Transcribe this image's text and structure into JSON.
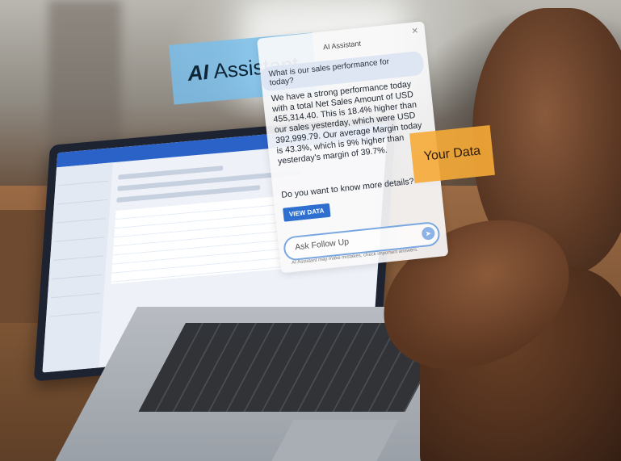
{
  "overlay_label": {
    "ai_bold": "AI",
    "ai_rest": "Assistant"
  },
  "panel": {
    "title": "AI Assistant",
    "question": "What is our sales performance for today?",
    "answer": "We have a strong performance today with a total Net Sales Amount of USD 455,314.40. This is 18.4% higher than our sales yesterday, which were USD 392,999.79. Our average Margin today is 43.3%, which is 9% higher than yesterday's margin of 39.7%.",
    "prompt": "Do you want to know more details?",
    "view_button": "VIEW DATA",
    "followup_placeholder": "Ask Follow Up",
    "disclaimer": "AI Assistant may make mistakes, check important answers."
  },
  "data_label": "Your Data",
  "icons": {
    "close": "close-icon",
    "send": "send-icon"
  },
  "colors": {
    "ai_label_bg": "#78beeb",
    "data_label_bg": "#f5aa37",
    "button_blue": "#2f6fd0"
  }
}
